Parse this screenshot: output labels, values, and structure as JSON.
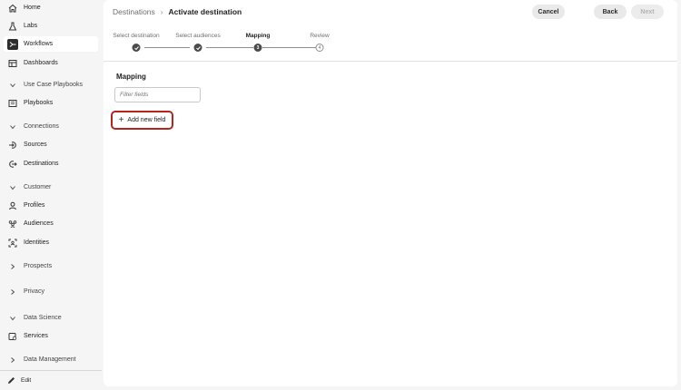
{
  "sidebar": {
    "items": [
      {
        "label": "Home",
        "icon": "home-icon"
      },
      {
        "label": "Labs",
        "icon": "flask-icon"
      },
      {
        "label": "Workflows",
        "icon": "workflow-icon"
      },
      {
        "label": "Dashboards",
        "icon": "dashboard-icon"
      },
      {
        "label": "Use Case Playbooks",
        "icon": "chevron-down-icon"
      },
      {
        "label": "Playbooks",
        "icon": "book-icon"
      },
      {
        "label": "Connections",
        "icon": "chevron-down-icon"
      },
      {
        "label": "Sources",
        "icon": "sources-icon"
      },
      {
        "label": "Destinations",
        "icon": "destinations-icon"
      },
      {
        "label": "Customer",
        "icon": "chevron-down-icon"
      },
      {
        "label": "Profiles",
        "icon": "user-icon"
      },
      {
        "label": "Audiences",
        "icon": "audiences-icon"
      },
      {
        "label": "Identities",
        "icon": "identity-icon"
      },
      {
        "label": "Prospects",
        "icon": "chevron-right-icon"
      },
      {
        "label": "Privacy",
        "icon": "chevron-right-icon"
      },
      {
        "label": "Data Science",
        "icon": "chevron-down-icon"
      },
      {
        "label": "Services",
        "icon": "services-icon"
      },
      {
        "label": "Data Management",
        "icon": "chevron-right-icon"
      }
    ],
    "edit_label": "Edit"
  },
  "header": {
    "breadcrumb_parent": "Destinations",
    "breadcrumb_separator": "›",
    "title": "Activate destination",
    "cancel_label": "Cancel",
    "back_label": "Back",
    "next_label": "Next"
  },
  "steps": [
    {
      "label": "Select destination",
      "state": "done"
    },
    {
      "label": "Select audiences",
      "state": "done"
    },
    {
      "label": "Mapping",
      "state": "current",
      "number": "3"
    },
    {
      "label": "Review",
      "state": "pending",
      "number": "4"
    }
  ],
  "mapping": {
    "title": "Mapping",
    "filter_placeholder": "Filter fields",
    "add_field_label": "Add new field"
  },
  "colors": {
    "highlight_border": "#b3261e",
    "active_icon_bg": "#2c2c2c"
  }
}
